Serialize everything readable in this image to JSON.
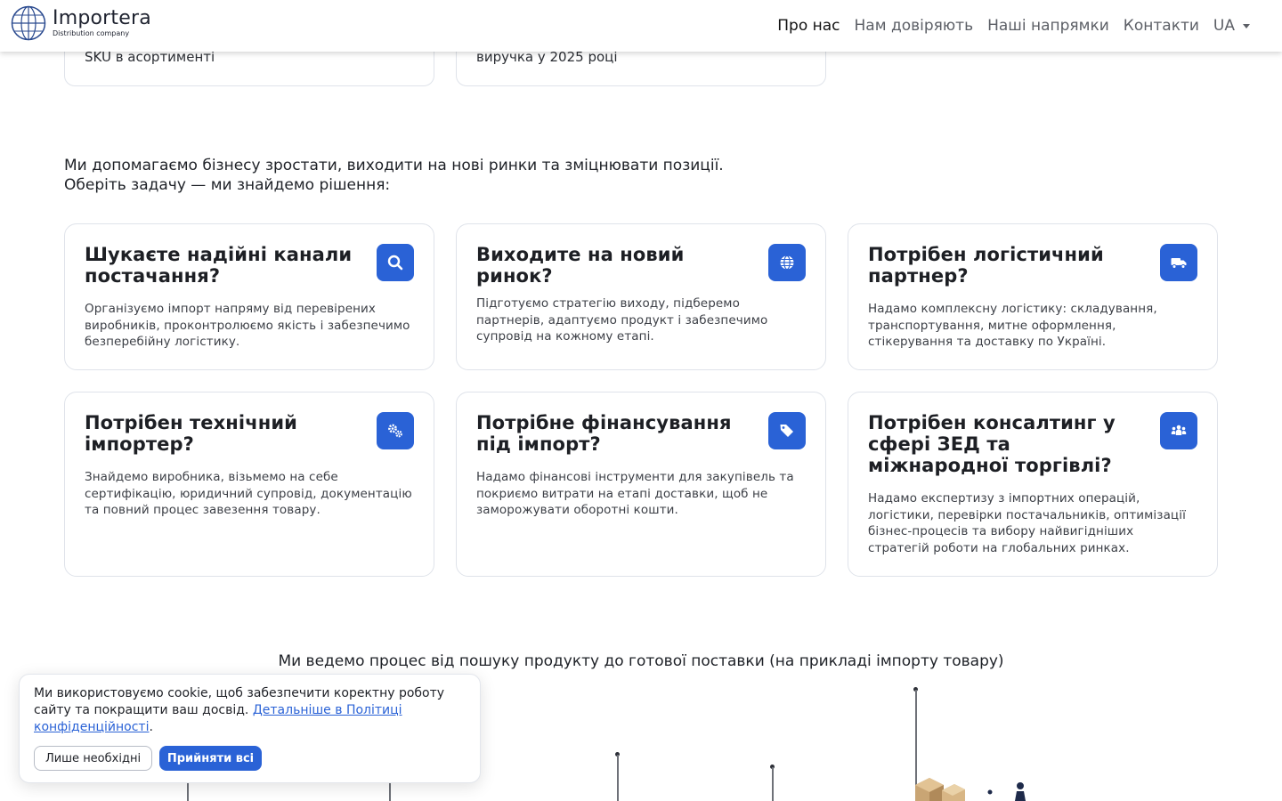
{
  "brand": {
    "name": "Importera",
    "subtitle": "Distribution company"
  },
  "nav": {
    "items": [
      "Про нас",
      "Нам довіряють",
      "Наші напрямки",
      "Контакти"
    ],
    "lang": "UA"
  },
  "stats": [
    "SKU в асортименті",
    "виручка у 2025 році"
  ],
  "intro": {
    "line1": "Ми допомагаємо бізнесу зростати, виходити на нові ринки та зміцнювати позиції.",
    "line2": "Оберіть задачу — ми знайдемо рішення:"
  },
  "cards": [
    {
      "title": "Шукаєте надійні канали постачання?",
      "text": "Організуємо імпорт напряму від перевірених виробників, проконтролюємо якість і забезпечимо безперебійну логістику.",
      "icon": "search-icon"
    },
    {
      "title": "Виходите на новий ринок?",
      "text": "Підготуємо стратегію виходу, підберемо партнерів, адаптуємо продукт і забезпечимо супровід на кожному етапі.",
      "icon": "globe-icon"
    },
    {
      "title": "Потрібен логістичний партнер?",
      "text": "Надамо комплексну логістику: складування, транспортування, митне оформлення, стікерування та доставку по Україні.",
      "icon": "truck-icon"
    },
    {
      "title": "Потрібен технічний імпортер?",
      "text": "Знайдемо виробника, візьмемо на себе сертифікацію, юридичний супровід, документацію та повний процес завезення товару.",
      "icon": "gears-icon"
    },
    {
      "title": "Потрібне фінансування під імпорт?",
      "text": "Надамо фінансові інструменти для закупівель та покриємо витрати на етапі доставки, щоб не заморожувати оборотні кошти.",
      "icon": "tags-icon"
    },
    {
      "title": "Потрібен консалтинг у сфері ЗЕД та міжнародної торгівлі?",
      "text": "Надамо експертизу з імпортних операцій, логістики, перевірки постачальників, оптимізації бізнес-процесів та вибору найвигідніших стратегій роботи на глобальних ринках.",
      "icon": "people-icon"
    }
  ],
  "process": {
    "title": "Ми ведемо процес від пошуку продукту до готової поставки (на прикладі імпорту товару)"
  },
  "cookie": {
    "text": "Ми використовуємо cookie, щоб забезпечити коректну роботу сайту та покращити ваш досвід. ",
    "link": "Детальніше в Політиці конфіденційності",
    "after": ".",
    "btn_necessary": "Лише необхідні",
    "btn_accept": "Прийняти всі"
  },
  "colors": {
    "accent": "#2a62d6",
    "border": "#dfe3ea"
  }
}
